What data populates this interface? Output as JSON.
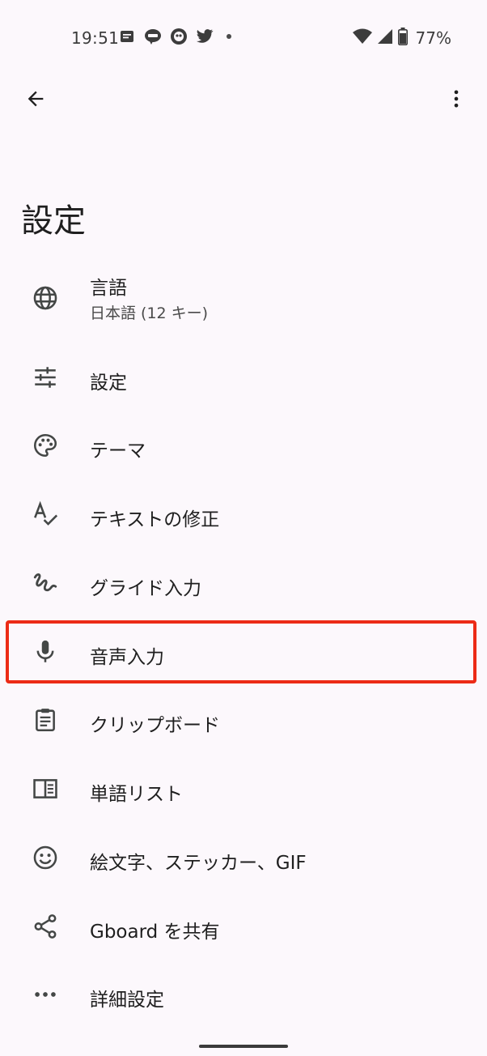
{
  "status_bar": {
    "time": "19:51",
    "notification_icons": [
      "message-icon",
      "line-icon",
      "app-icon",
      "twitter-icon"
    ],
    "battery": "77%"
  },
  "app_bar": {
    "back_icon": "arrow-back-icon",
    "more_icon": "more-vert-icon"
  },
  "page": {
    "title": "設定"
  },
  "items": [
    {
      "id": "language",
      "icon": "globe-icon",
      "label": "言語",
      "sub": "日本語 (12 キー)"
    },
    {
      "id": "preferences",
      "icon": "tune-icon",
      "label": "設定"
    },
    {
      "id": "theme",
      "icon": "palette-icon",
      "label": "テーマ"
    },
    {
      "id": "text-correction",
      "icon": "spellcheck-icon",
      "label": "テキストの修正"
    },
    {
      "id": "glide-typing",
      "icon": "gesture-icon",
      "label": "グライド入力"
    },
    {
      "id": "voice-typing",
      "icon": "mic-icon",
      "label": "音声入力"
    },
    {
      "id": "clipboard",
      "icon": "clipboard-icon",
      "label": "クリップボード"
    },
    {
      "id": "dictionary",
      "icon": "book-icon",
      "label": "単語リスト"
    },
    {
      "id": "emoji",
      "icon": "smiley-icon",
      "label": "絵文字、ステッカー、GIF"
    },
    {
      "id": "share",
      "icon": "share-icon",
      "label": "Gboard を共有"
    },
    {
      "id": "advanced",
      "icon": "more-horiz-icon",
      "label": "詳細設定"
    }
  ],
  "colors": {
    "background": "#fcf8fc",
    "highlight": "#ec2b16",
    "text": "#1f1f1f",
    "icon": "#444746"
  }
}
